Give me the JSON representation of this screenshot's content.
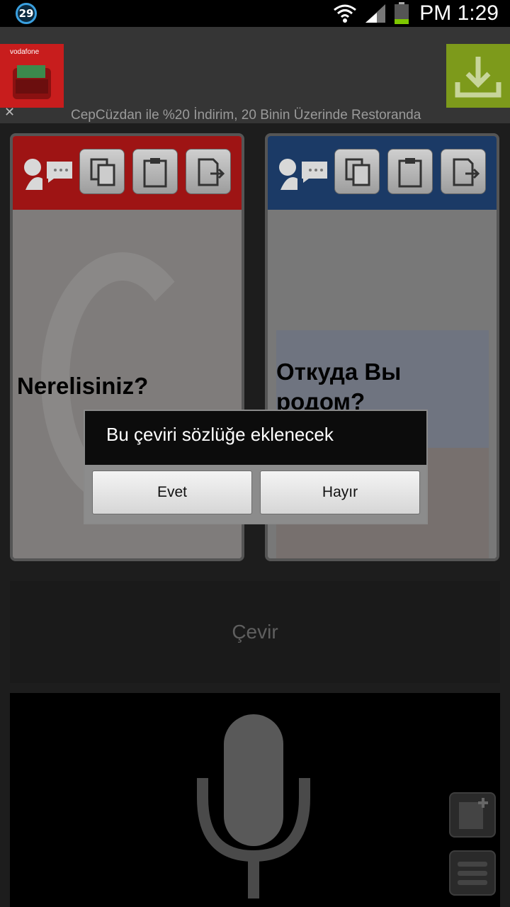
{
  "status_bar": {
    "notification_count": "29",
    "time": "PM 1:29",
    "icons": [
      "wifi-icon",
      "signal-icon",
      "battery-icon"
    ]
  },
  "ad": {
    "brand": "vodafone",
    "text": "CepCüzdan ile %20 İndirim, 20 Binin Üzerinde Restoranda",
    "close": "✕"
  },
  "source_panel": {
    "phrase": "Nerelisiniz?",
    "header_color": "#9e1414"
  },
  "target_panel": {
    "phrase": "Откуда Вы родом?",
    "header_color": "#1b3a66"
  },
  "translate_button": {
    "label": "Çevir"
  },
  "dialog": {
    "message": "Bu çeviri sözlüğe eklenecek",
    "yes_label": "Evet",
    "no_label": "Hayır"
  },
  "colors": {
    "ad_download": "#7d9a1b",
    "badge": "#3aa0e0"
  }
}
